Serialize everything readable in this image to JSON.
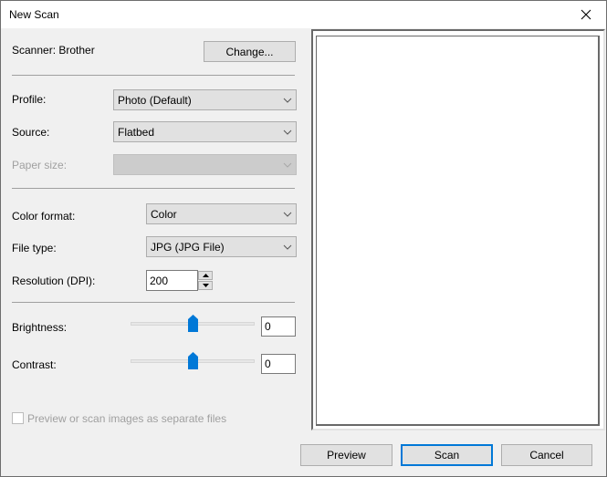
{
  "window": {
    "title": "New Scan",
    "close_icon": "close-x-icon"
  },
  "scanner": {
    "label": "Scanner: Brother",
    "change_button": "Change..."
  },
  "fields": {
    "profile": {
      "label": "Profile:",
      "value": "Photo (Default)"
    },
    "source": {
      "label": "Source:",
      "value": "Flatbed"
    },
    "paper_size": {
      "label": "Paper size:",
      "value": "",
      "disabled": true
    },
    "color_format": {
      "label": "Color format:",
      "value": "Color"
    },
    "file_type": {
      "label": "File type:",
      "value": "JPG (JPG File)"
    },
    "resolution": {
      "label": "Resolution (DPI):",
      "value": "200"
    },
    "brightness": {
      "label": "Brightness:",
      "value": "0",
      "slider_fraction": 0.5
    },
    "contrast": {
      "label": "Contrast:",
      "value": "0",
      "slider_fraction": 0.5
    }
  },
  "options": {
    "separate_files": {
      "label": "Preview or scan images as separate files",
      "checked": false,
      "disabled": true
    }
  },
  "buttons": {
    "preview": "Preview",
    "scan": "Scan",
    "cancel": "Cancel"
  },
  "colors": {
    "accent": "#0078d7",
    "dialog_bg": "#f0f0f0",
    "button_bg": "#e1e1e1"
  }
}
